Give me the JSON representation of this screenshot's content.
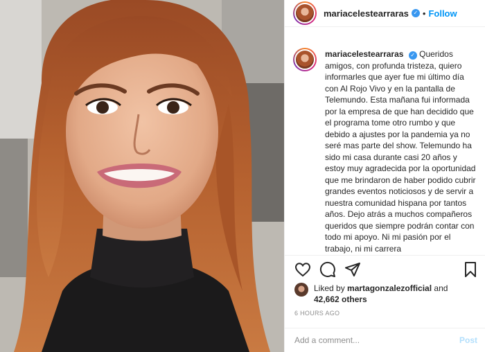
{
  "post": {
    "username": "mariacelestearraras",
    "verified_icon": "verified-badge-icon",
    "separator": "•",
    "follow_label": "Follow"
  },
  "caption": {
    "username": "mariacelestearraras",
    "text": "Queridos amigos, con profunda tristeza, quiero informarles que ayer fue mi último día con Al Rojo Vivo y en la pantalla de Telemundo. Esta mañana fui informada por la empresa de que han decidido que el programa tome otro rumbo y que debido a ajustes por la pandemia ya no seré mas parte del show. Telemundo ha sido mi casa durante casi 20 años y estoy muy agradecida por la oportunidad que me brindaron de haber podido cubrir grandes eventos noticiosos y de servir a nuestra comunidad hispana por tantos años. Dejo atrás a muchos compañeros queridos que siempre podrán contar con todo mi apoyo. Ni mi pasión por el trabajo, ni mi carrera"
  },
  "actions": {
    "like_icon": "heart-icon",
    "comment_icon": "comment-icon",
    "share_icon": "share-icon",
    "save_icon": "bookmark-icon"
  },
  "likes": {
    "prefix": "Liked by ",
    "user": "martagonzalezofficial",
    "middle": " and",
    "count": "42,662 others"
  },
  "timestamp": "6 HOURS AGO",
  "comment_box": {
    "placeholder": "Add a comment...",
    "post_label": "Post"
  },
  "colors": {
    "accent": "#0095f6",
    "post_disabled": "#b2dffc",
    "text": "#262626",
    "muted": "#8e8e8e"
  }
}
